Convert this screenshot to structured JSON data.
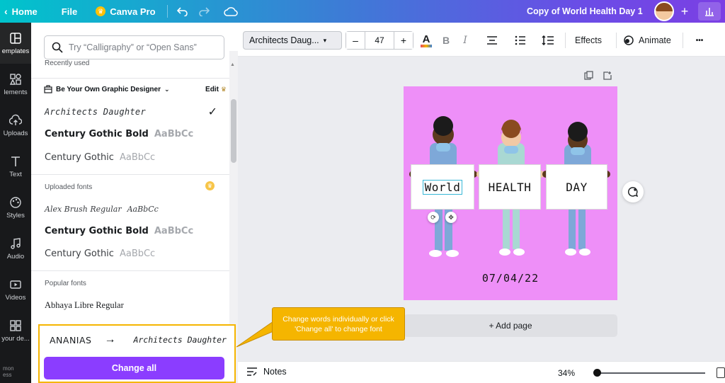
{
  "topbar": {
    "home": "Home",
    "file": "File",
    "pro": "Canva Pro",
    "title": "Copy of World Health Day 1"
  },
  "rail": {
    "items": [
      "emplates",
      "lements",
      "Uploads",
      "Text",
      "Styles",
      "Audio",
      "Videos",
      "your de..."
    ],
    "logo_line1": "mon",
    "logo_line2": "ess"
  },
  "panel": {
    "search_placeholder": "Try “Calligraphy” or “Open Sans”",
    "recently_used": "Recently used",
    "brand_kit": "Be Your Own Graphic Designer",
    "edit": "Edit",
    "recent_fonts": [
      {
        "name": "Architects Daughter",
        "sample": ""
      },
      {
        "name": "Century Gothic Bold",
        "sample": "AaBbCc"
      },
      {
        "name": "Century Gothic",
        "sample": "AaBbCc"
      }
    ],
    "uploaded_label": "Uploaded fonts",
    "uploaded_fonts": [
      {
        "name": "Alex Brush Regular",
        "sample": "AaBbCc"
      },
      {
        "name": "Century Gothic Bold",
        "sample": "AaBbCc"
      },
      {
        "name": "Century Gothic",
        "sample": "AaBbCc"
      }
    ],
    "popular_label": "Popular fonts",
    "popular_fonts": [
      {
        "name": "Abhaya Libre Regular"
      }
    ],
    "replace": {
      "from": "ANANIAS",
      "arrow": "→",
      "to": "Architects Daughter",
      "button": "Change all"
    }
  },
  "toolbar": {
    "font": "Architects Daug...",
    "size": "47",
    "minus": "–",
    "plus": "+",
    "effects": "Effects",
    "animate": "Animate",
    "more": "•••",
    "text_color": "#e84a5f"
  },
  "canvas": {
    "signs": [
      "World",
      "HEALTH",
      "DAY"
    ],
    "date": "07/04/22",
    "background": "#ee8ff8",
    "add_page": "+ Add page"
  },
  "callout": {
    "text": "Change words individually or click 'Change all' to change font"
  },
  "bottombar": {
    "notes": "Notes",
    "zoom": "34%"
  },
  "colors": {
    "accent": "#8b3dff",
    "highlight": "#f5b500"
  }
}
